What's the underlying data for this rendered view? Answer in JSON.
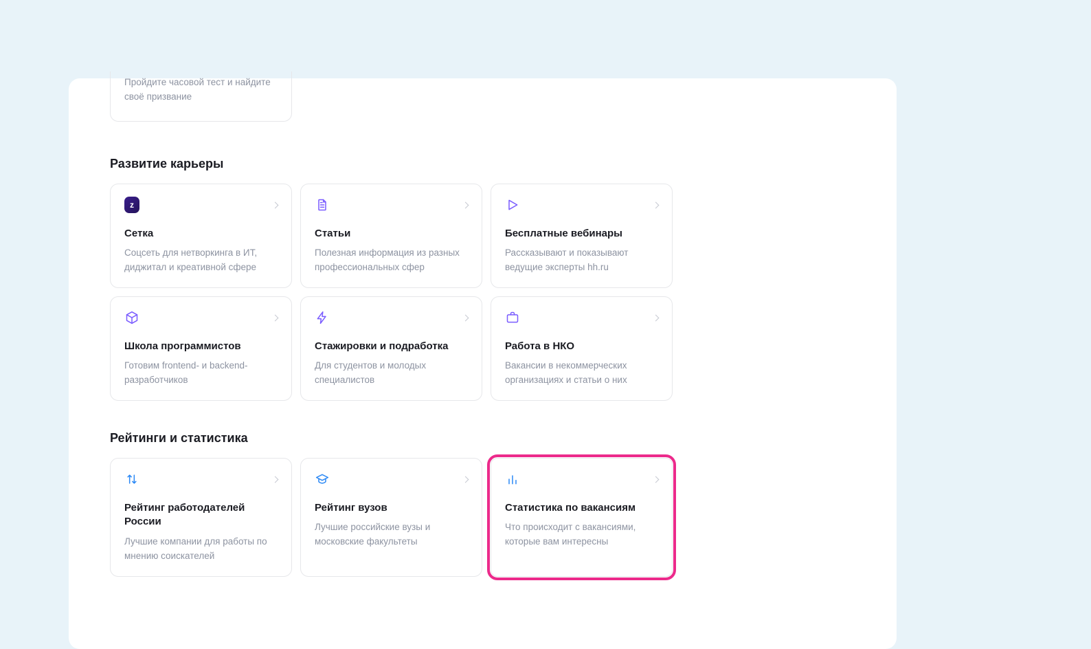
{
  "partial_card": {
    "desc": "Пройдите часовой тест и найдите своё призвание"
  },
  "sections": {
    "career": {
      "title": "Развитие карьеры",
      "cards": [
        {
          "icon": "badge",
          "badgeText": "z",
          "title": "Сетка",
          "desc": "Соцсеть для нетворкинга в ИТ, диджитал и креативной сфере"
        },
        {
          "icon": "document",
          "title": "Статьи",
          "desc": "Полезная информация из разных профессиональных сфер"
        },
        {
          "icon": "play",
          "title": "Бесплатные вебинары",
          "desc": "Рассказывают и показывают ведущие эксперты hh.ru"
        },
        {
          "icon": "cube",
          "title": "Школа программистов",
          "desc": "Готовим frontend- и backend-разработчиков"
        },
        {
          "icon": "bolt",
          "title": "Стажировки и подработка",
          "desc": "Для студентов и молодых специалистов"
        },
        {
          "icon": "briefcase",
          "title": "Работа в НКО",
          "desc": "Вакансии в некоммерческих организациях и статьи о них"
        }
      ]
    },
    "ratings": {
      "title": "Рейтинги и статистика",
      "cards": [
        {
          "icon": "sort",
          "blue": true,
          "title": "Рейтинг работодателей России",
          "desc": "Лучшие компании для работы по мнению соискателей"
        },
        {
          "icon": "graduation",
          "blue": true,
          "title": "Рейтинг вузов",
          "desc": "Лучшие российские вузы и московские факультеты"
        },
        {
          "icon": "chart",
          "blue": true,
          "title": "Статистика по вакансиям",
          "desc": "Что происходит с вакансиями, которые вам интересны",
          "highlighted": true
        }
      ]
    }
  }
}
